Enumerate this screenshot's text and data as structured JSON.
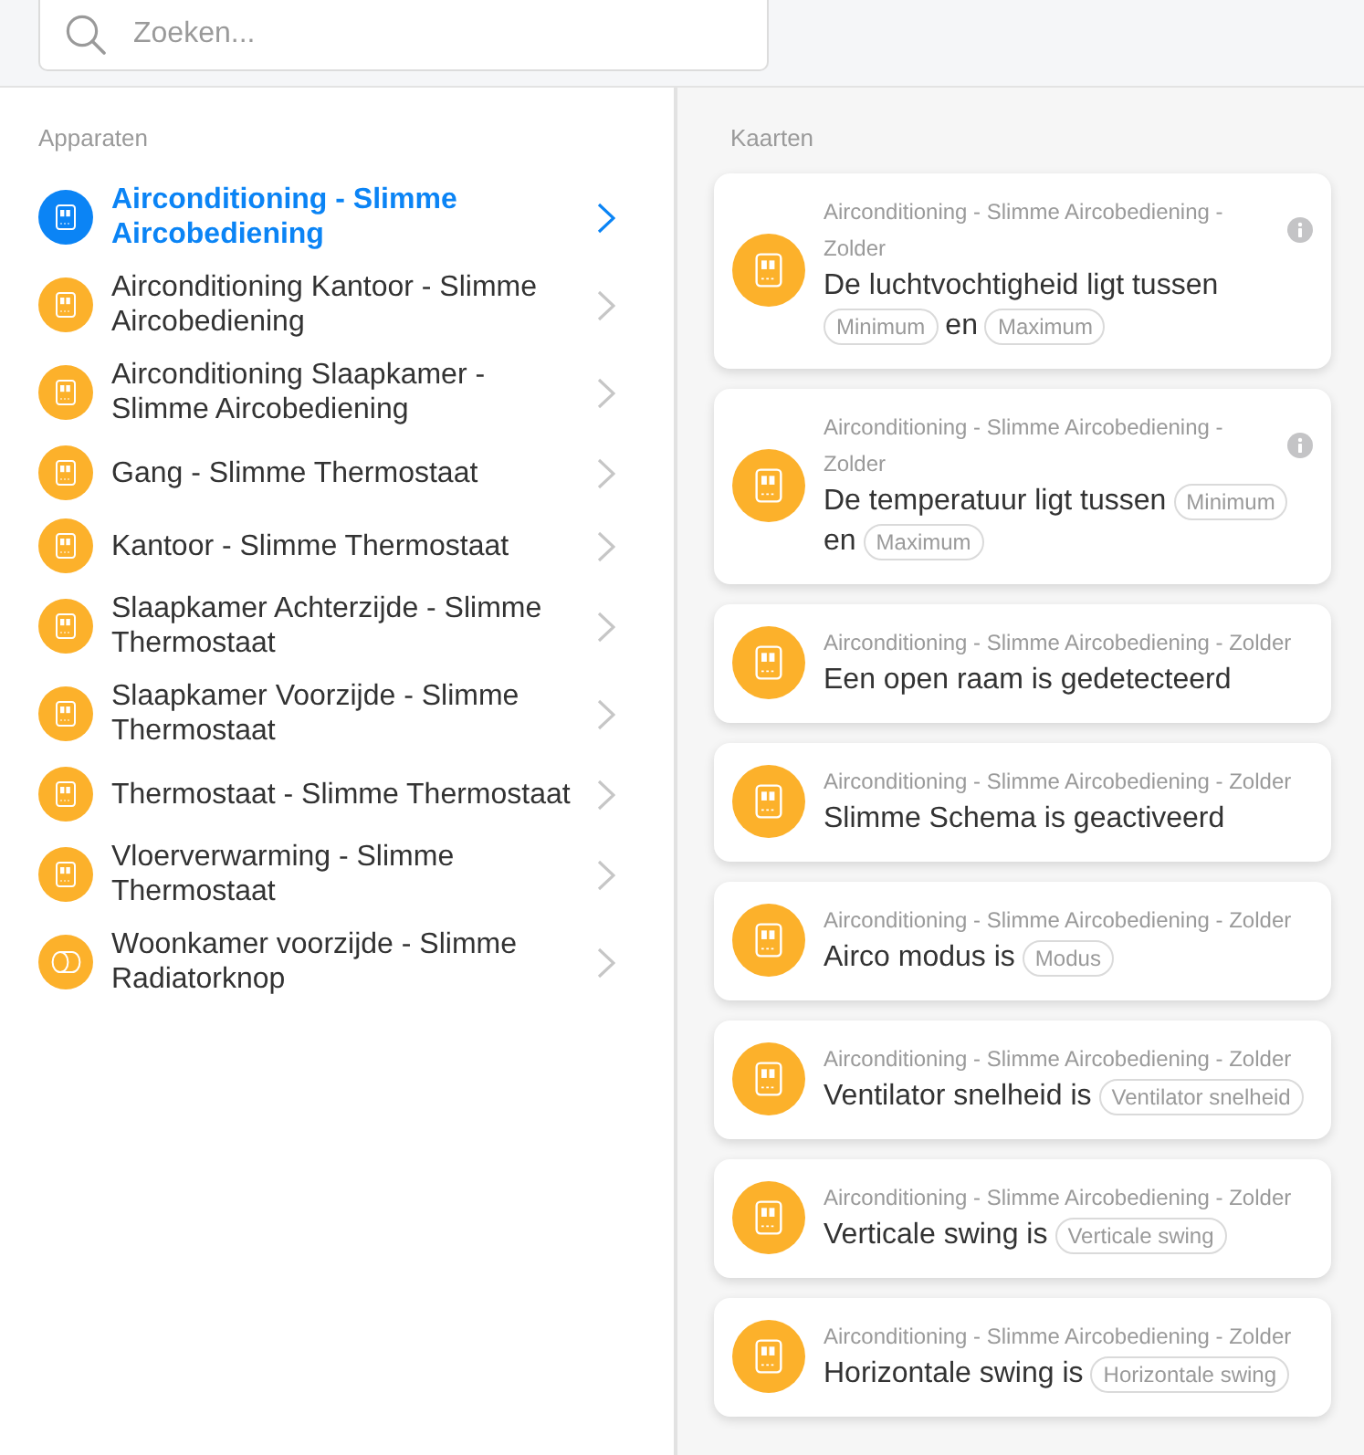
{
  "search": {
    "placeholder": "Zoeken..."
  },
  "devices": {
    "heading": "Apparaten",
    "items": [
      {
        "name": "Airconditioning - Slimme Aircobediening",
        "kind": "thermostat",
        "selected": true
      },
      {
        "name": "Airconditioning Kantoor - Slimme Aircobediening",
        "kind": "thermostat",
        "selected": false
      },
      {
        "name": "Airconditioning Slaapkamer - Slimme Aircobediening",
        "kind": "thermostat",
        "selected": false
      },
      {
        "name": "Gang - Slimme Thermostaat",
        "kind": "thermostat",
        "selected": false
      },
      {
        "name": "Kantoor - Slimme Thermostaat",
        "kind": "thermostat",
        "selected": false
      },
      {
        "name": "Slaapkamer Achterzijde - Slimme Thermostaat",
        "kind": "thermostat",
        "selected": false
      },
      {
        "name": "Slaapkamer Voorzijde - Slimme Thermostaat",
        "kind": "thermostat",
        "selected": false
      },
      {
        "name": "Thermostaat - Slimme Thermostaat",
        "kind": "thermostat",
        "selected": false
      },
      {
        "name": "Vloerverwarming - Slimme Thermostaat",
        "kind": "thermostat",
        "selected": false
      },
      {
        "name": "Woonkamer voorzijde - Slimme Radiatorknop",
        "kind": "radiator_knob",
        "selected": false
      }
    ]
  },
  "cards": {
    "heading": "Kaarten",
    "items": [
      {
        "device": "Airconditioning - Slimme Aircobediening - Zolder",
        "info": true,
        "parts": [
          {
            "kind": "text",
            "text": "De luchtvochtigheid ligt tussen"
          },
          {
            "kind": "token",
            "text": "Minimum"
          },
          {
            "kind": "text",
            "text": "en"
          },
          {
            "kind": "token",
            "text": "Maximum"
          }
        ]
      },
      {
        "device": "Airconditioning - Slimme Aircobediening - Zolder",
        "info": true,
        "parts": [
          {
            "kind": "text",
            "text": "De temperatuur ligt tussen"
          },
          {
            "kind": "token",
            "text": "Minimum"
          },
          {
            "kind": "text",
            "text": "en"
          },
          {
            "kind": "token",
            "text": "Maximum"
          }
        ]
      },
      {
        "device": "Airconditioning - Slimme Aircobediening - Zolder",
        "info": false,
        "parts": [
          {
            "kind": "text",
            "text": "Een open raam is gedetecteerd"
          }
        ]
      },
      {
        "device": "Airconditioning - Slimme Aircobediening - Zolder",
        "info": false,
        "parts": [
          {
            "kind": "text",
            "text": "Slimme Schema is geactiveerd"
          }
        ]
      },
      {
        "device": "Airconditioning - Slimme Aircobediening - Zolder",
        "info": false,
        "parts": [
          {
            "kind": "text",
            "text": "Airco modus is"
          },
          {
            "kind": "token",
            "text": "Modus"
          }
        ]
      },
      {
        "device": "Airconditioning - Slimme Aircobediening - Zolder",
        "info": false,
        "parts": [
          {
            "kind": "text",
            "text": "Ventilator snelheid is"
          },
          {
            "kind": "token",
            "text": "Ventilator snelheid"
          }
        ]
      },
      {
        "device": "Airconditioning - Slimme Aircobediening - Zolder",
        "info": false,
        "parts": [
          {
            "kind": "text",
            "text": "Verticale swing is"
          },
          {
            "kind": "token",
            "text": "Verticale swing"
          }
        ]
      },
      {
        "device": "Airconditioning - Slimme Aircobediening - Zolder",
        "info": false,
        "parts": [
          {
            "kind": "text",
            "text": "Horizontale swing is"
          },
          {
            "kind": "token",
            "text": "Horizontale swing"
          }
        ]
      }
    ]
  }
}
